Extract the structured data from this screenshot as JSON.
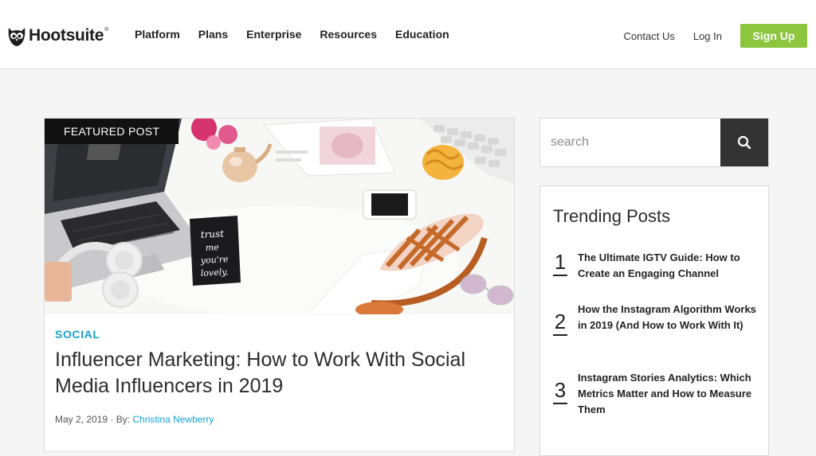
{
  "header": {
    "logo_text": "Hootsuite",
    "logo_mark": "®",
    "nav": [
      "Platform",
      "Plans",
      "Enterprise",
      "Resources",
      "Education"
    ],
    "contact": "Contact Us",
    "login": "Log In",
    "signup": "Sign Up",
    "accent_color": "#8cc63f"
  },
  "featured": {
    "badge": "FEATURED POST",
    "category": "SOCIAL",
    "title": "Influencer Marketing: How to Work With Social Media Influencers in 2019",
    "date": "May 2, 2019",
    "by_label": " · By: ",
    "author": "Christina Newberry",
    "card_text": "trust me, you're lovely.",
    "link_color": "#1aa1d4"
  },
  "sidebar": {
    "search_placeholder": "search",
    "search_icon": "magnifier-icon",
    "trending_title": "Trending Posts",
    "trending": [
      {
        "num": "1",
        "title": "The Ultimate IGTV Guide: How to Create an Engaging Channel"
      },
      {
        "num": "2",
        "title": "How the Instagram Algorithm Works in 2019 (And How to Work With It)"
      },
      {
        "num": "3",
        "title": "Instagram Stories Analytics: Which Metrics Matter and How to Measure Them"
      }
    ]
  }
}
